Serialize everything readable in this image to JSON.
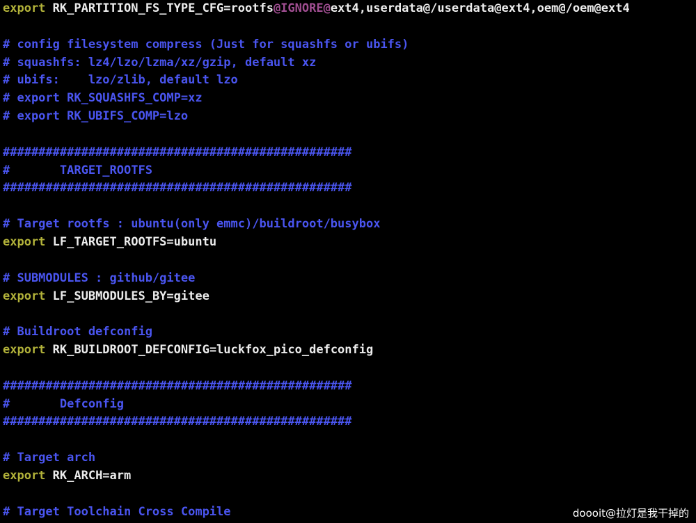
{
  "editor": {
    "lines": [
      {
        "segments": [
          {
            "kind": "kw",
            "text": "export"
          },
          {
            "kind": "var",
            "text": " RK_PARTITION_FS_TYPE_CFG=rootfs"
          },
          {
            "kind": "ig",
            "text": "@IGNORE@"
          },
          {
            "kind": "var",
            "text": "ext4,userdata@/userdata@ext4,oem@/oem@ext4"
          }
        ]
      },
      {
        "segments": []
      },
      {
        "segments": [
          {
            "kind": "cm",
            "text": "# config filesystem compress (Just for squashfs or ubifs)"
          }
        ]
      },
      {
        "segments": [
          {
            "kind": "cm",
            "text": "# squashfs: lz4/lzo/lzma/xz/gzip, default xz"
          }
        ]
      },
      {
        "segments": [
          {
            "kind": "cm",
            "text": "# ubifs:    lzo/zlib, default lzo"
          }
        ]
      },
      {
        "segments": [
          {
            "kind": "cm",
            "text": "# export RK_SQUASHFS_COMP=xz"
          }
        ]
      },
      {
        "segments": [
          {
            "kind": "cm",
            "text": "# export RK_UBIFS_COMP=lzo"
          }
        ]
      },
      {
        "segments": []
      },
      {
        "segments": [
          {
            "kind": "cm",
            "text": "#################################################"
          }
        ]
      },
      {
        "segments": [
          {
            "kind": "cm",
            "text": "#       TARGET_ROOTFS"
          }
        ]
      },
      {
        "segments": [
          {
            "kind": "cm",
            "text": "#################################################"
          }
        ]
      },
      {
        "segments": []
      },
      {
        "segments": [
          {
            "kind": "cm",
            "text": "# Target rootfs : ubuntu(only emmc)/buildroot/busybox"
          }
        ]
      },
      {
        "segments": [
          {
            "kind": "kw",
            "text": "export"
          },
          {
            "kind": "var",
            "text": " LF_TARGET_ROOTFS=ubuntu"
          }
        ]
      },
      {
        "segments": []
      },
      {
        "segments": [
          {
            "kind": "cm",
            "text": "# SUBMODULES : github/gitee"
          }
        ]
      },
      {
        "segments": [
          {
            "kind": "kw",
            "text": "export"
          },
          {
            "kind": "var",
            "text": " LF_SUBMODULES_BY=gitee"
          }
        ]
      },
      {
        "segments": []
      },
      {
        "segments": [
          {
            "kind": "cm",
            "text": "# Buildroot defconfig"
          }
        ]
      },
      {
        "segments": [
          {
            "kind": "kw",
            "text": "export"
          },
          {
            "kind": "var",
            "text": " RK_BUILDROOT_DEFCONFIG=luckfox_pico_defconfig"
          }
        ]
      },
      {
        "segments": []
      },
      {
        "segments": [
          {
            "kind": "cm",
            "text": "#################################################"
          }
        ]
      },
      {
        "segments": [
          {
            "kind": "cm",
            "text": "#       Defconfig"
          }
        ]
      },
      {
        "segments": [
          {
            "kind": "cm",
            "text": "#################################################"
          }
        ]
      },
      {
        "segments": []
      },
      {
        "segments": [
          {
            "kind": "cm",
            "text": "# Target arch"
          }
        ]
      },
      {
        "segments": [
          {
            "kind": "kw",
            "text": "export"
          },
          {
            "kind": "var",
            "text": " RK_ARCH=arm"
          }
        ]
      },
      {
        "segments": []
      },
      {
        "segments": [
          {
            "kind": "cm",
            "text": "# Target Toolchain Cross Compile"
          }
        ]
      }
    ]
  },
  "watermark": {
    "text": "doooit@拉灯是我干掉的"
  },
  "colors": {
    "background": "#000000",
    "keyword": "#b3b33a",
    "variable": "#ececec",
    "comment": "#4a55f0",
    "ignore": "#a04e91"
  }
}
